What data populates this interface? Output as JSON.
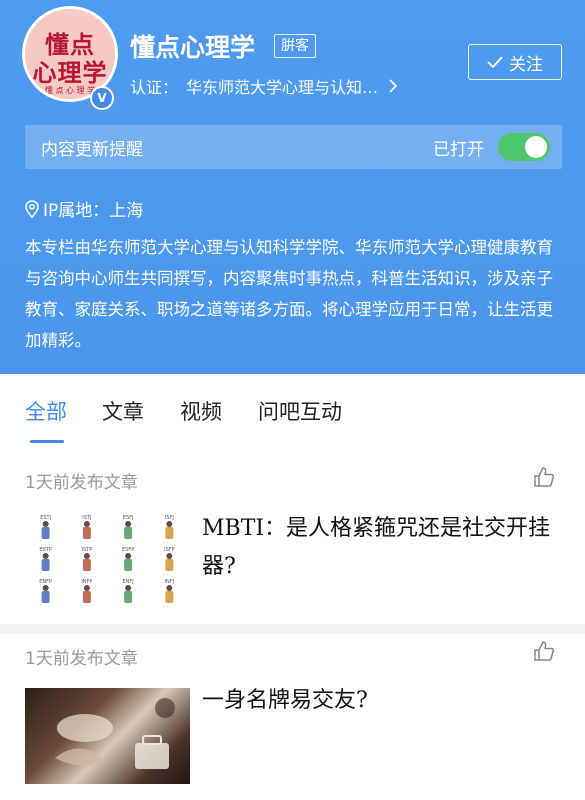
{
  "profile": {
    "name": "懂点心理学",
    "author_tag": "腁客",
    "follow_label": "关注",
    "verify_label": "认证：",
    "verify_text": "华东师范大学心理与认知…",
    "avatar": {
      "line1": "懂点",
      "line2": "心理学",
      "subtitle": "懂 点 心 理 学",
      "badge": "V"
    },
    "notify_label": "内容更新提醒",
    "notify_status": "已打开",
    "notify_on": true,
    "ip_text": "IP属地：上海",
    "description": "本专栏由华东师范大学心理与认知科学学院、华东师范大学心理健康教育与咨询中心师生共同撰写，内容聚焦时事热点，科普生活知识，涉及亲子教育、家庭关系、职场之道等诸多方面。将心理学应用于日常，让生活更加精彩。"
  },
  "tabs": [
    {
      "label": "全部",
      "active": true
    },
    {
      "label": "文章",
      "active": false
    },
    {
      "label": "视频",
      "active": false
    },
    {
      "label": "问吧互动",
      "active": false
    }
  ],
  "feed": [
    {
      "meta": "1天前发布文章",
      "title": "MBTI：是人格紧箍咒还是社交开挂器?",
      "thumb_labels": [
        "ESTJ",
        "ISTJ",
        "ESFJ",
        "ISFJ",
        "ESTP",
        "ISTP",
        "ESFP",
        "ISFP",
        "ENFP",
        "INFP",
        "ENFJ",
        "INFJ"
      ]
    },
    {
      "meta": "1天前发布文章",
      "title": "一身名牌易交友?"
    }
  ],
  "colors": {
    "header_bg": "#4f9bf0",
    "accent": "#3d8ce6",
    "toggle_on": "#4cc76a"
  },
  "icons": [
    "check-icon",
    "chevron-right-icon",
    "location-pin-icon",
    "like-icon"
  ]
}
